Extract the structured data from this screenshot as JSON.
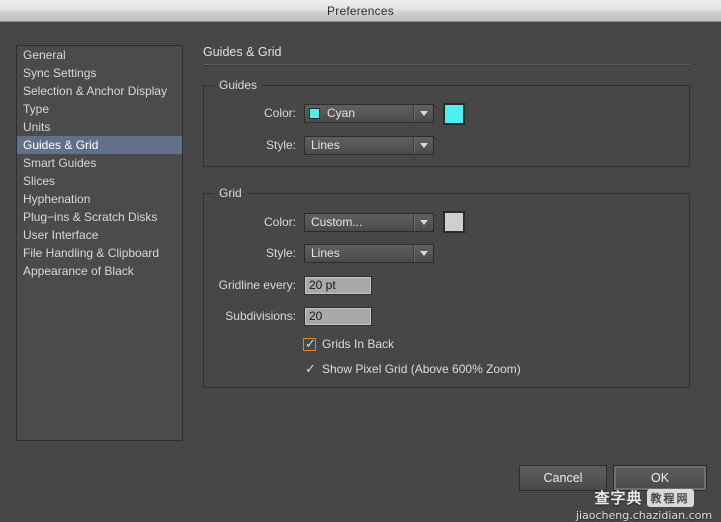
{
  "window": {
    "title": "Preferences"
  },
  "sidebar": {
    "items": [
      {
        "label": "General",
        "selected": false
      },
      {
        "label": "Sync Settings",
        "selected": false
      },
      {
        "label": "Selection & Anchor Display",
        "selected": false
      },
      {
        "label": "Type",
        "selected": false
      },
      {
        "label": "Units",
        "selected": false
      },
      {
        "label": "Guides & Grid",
        "selected": true
      },
      {
        "label": "Smart Guides",
        "selected": false
      },
      {
        "label": "Slices",
        "selected": false
      },
      {
        "label": "Hyphenation",
        "selected": false
      },
      {
        "label": "Plug−ins & Scratch Disks",
        "selected": false
      },
      {
        "label": "User Interface",
        "selected": false
      },
      {
        "label": "File Handling & Clipboard",
        "selected": false
      },
      {
        "label": "Appearance of Black",
        "selected": false
      }
    ]
  },
  "pane": {
    "title": "Guides & Grid"
  },
  "guides": {
    "legend": "Guides",
    "color_label": "Color:",
    "color_value": "Cyan",
    "color_hex": "#4ef0ee",
    "swatch_hex": "#4ef0ee",
    "style_label": "Style:",
    "style_value": "Lines"
  },
  "grid": {
    "legend": "Grid",
    "color_label": "Color:",
    "color_value": "Custom...",
    "swatch_hex": "#cfcfcf",
    "style_label": "Style:",
    "style_value": "Lines",
    "gridline_label": "Gridline every:",
    "gridline_value": "20 pt",
    "subdivisions_label": "Subdivisions:",
    "subdivisions_value": "20",
    "grids_in_back": {
      "label": "Grids In Back",
      "checked": true,
      "focused": true,
      "check_glyph": "✓"
    },
    "show_pixel_grid": {
      "label": "Show Pixel Grid (Above 600% Zoom)",
      "checked": true,
      "focused": false,
      "check_glyph": "✓"
    }
  },
  "buttons": {
    "cancel": "Cancel",
    "ok": "OK"
  },
  "watermark": {
    "cn_text": "查字典",
    "cn_box": "教程网",
    "url": "jiaocheng.chazidian.com"
  },
  "colors": {
    "window_bg": "#474747",
    "titlebar_text": "#2e2e2e",
    "selection": "#62708a",
    "focus_ring": "#d98b29",
    "guide_cyan": "#4ef0ee",
    "grid_custom": "#cfcfcf"
  }
}
